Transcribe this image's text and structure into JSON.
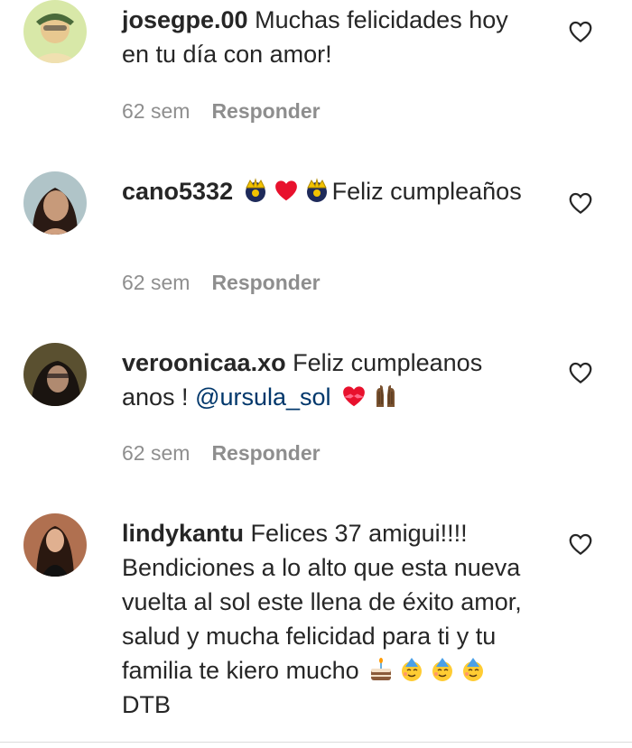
{
  "comments": [
    {
      "username": "josegpe.00",
      "text": "Muchas felicidades hoy en tu día con amor!",
      "time": "62 sem",
      "reply": "Responder",
      "avatar_icon": "profile-photo-icon",
      "like_icon": "heart-outline-icon"
    },
    {
      "username": "cano5332",
      "text_after": "Feliz cumpleaños",
      "emojis": [
        "crown-emoji",
        "red-heart-emoji",
        "crown-emoji"
      ],
      "time": "62 sem",
      "reply": "Responder",
      "avatar_icon": "profile-photo-icon",
      "like_icon": "heart-outline-icon"
    },
    {
      "username": "veroonicaa.xo",
      "text": "Feliz cumpleanos anos !",
      "mention": "@ursula_sol",
      "emojis": [
        "heart-with-ribbon-emoji",
        "raised-hands-emoji"
      ],
      "time": "62 sem",
      "reply": "Responder",
      "avatar_icon": "profile-photo-icon",
      "like_icon": "heart-outline-icon"
    },
    {
      "username": "lindykantu",
      "text": "Felices 37 amigui!!!! Bendiciones a lo alto que esta nueva vuelta al sol este llena de éxito amor, salud y mucha felicidad para ti y tu familia te kiero mucho",
      "emojis": [
        "birthday-cake-emoji",
        "partying-face-emoji",
        "partying-face-emoji",
        "partying-face-emoji"
      ],
      "text_after": "DTB",
      "avatar_icon": "profile-photo-icon",
      "like_icon": "heart-outline-icon"
    }
  ],
  "colors": {
    "text": "#262626",
    "meta": "#8e8e8e",
    "mention": "#00376b",
    "divider": "#dbdbdb"
  }
}
